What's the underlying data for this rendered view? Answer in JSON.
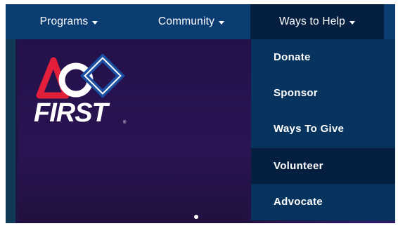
{
  "nav": {
    "items": [
      {
        "label": "Programs"
      },
      {
        "label": "Community"
      },
      {
        "label": "Ways to Help"
      }
    ]
  },
  "dropdown": {
    "items": [
      {
        "label": "Donate"
      },
      {
        "label": "Sponsor"
      },
      {
        "label": "Ways To Give"
      },
      {
        "label": "Volunteer",
        "state": "hovered"
      },
      {
        "label": "Advocate"
      }
    ]
  },
  "logo": {
    "text": "FIRST",
    "tm": "®",
    "colors": {
      "red": "#e21f3b",
      "blue": "#1b4fa3",
      "white": "#ffffff"
    }
  },
  "theme": {
    "nav_bg": "#0b3d73",
    "nav_active_bg": "#041f40",
    "hero_bg": "#241244"
  },
  "carousel": {
    "icon": "slide-indicator-dot-icon"
  }
}
